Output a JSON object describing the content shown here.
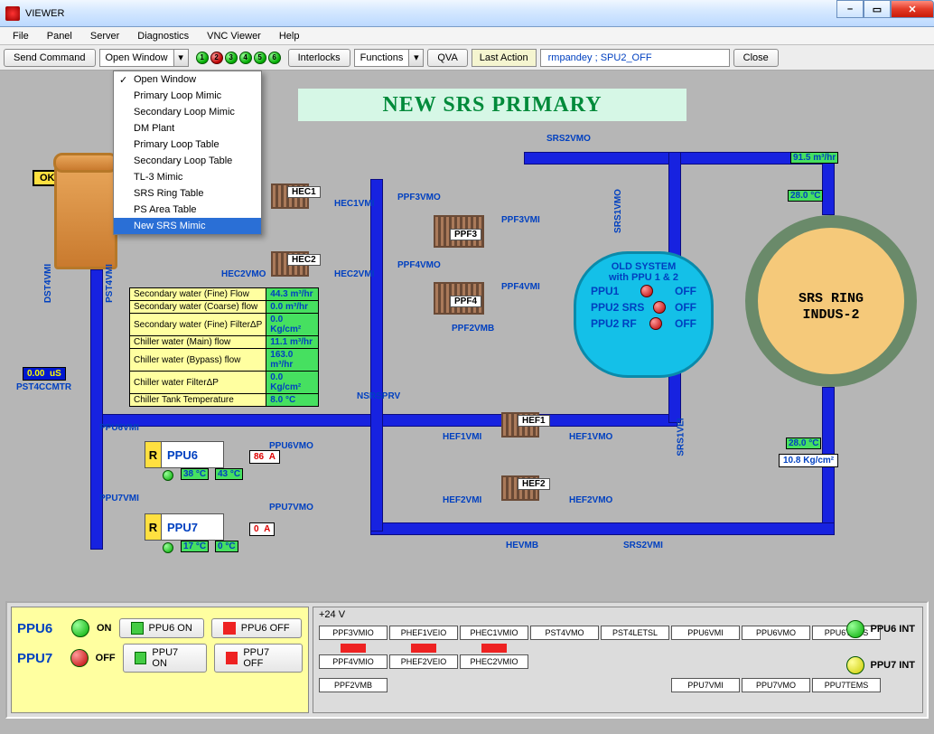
{
  "window": {
    "title": "VIEWER"
  },
  "winbtns": {
    "min": "–",
    "max": "▭",
    "close_sym": "✕"
  },
  "menu": [
    "File",
    "Panel",
    "Server",
    "Diagnostics",
    "VNC Viewer",
    "Help"
  ],
  "toolbar": {
    "send": "Send Command",
    "window_combo": "Open Window",
    "interlocks": "Interlocks",
    "functions": "Functions",
    "qva": "QVA",
    "last_action": "Last Action",
    "user": "rmpandey ; SPU2_OFF",
    "close": "Close",
    "dots": [
      "1",
      "2",
      "3",
      "4",
      "5",
      "6"
    ]
  },
  "dropdown": [
    "Open Window",
    "Primary Loop Mimic",
    "Secondary Loop Mimic",
    "DM Plant",
    "Primary Loop Table",
    "Secondary Loop Table",
    "TL-3 Mimic",
    "SRS Ring Table",
    "PS Area Table",
    "New SRS Mimic"
  ],
  "dropdown_checked": 0,
  "dropdown_selected": 9,
  "title_banner": "NEW SRS PRIMARY",
  "ok_label": "OK",
  "labels": {
    "SRS2VMO": "SRS2VMO",
    "HEC1": "HEC1",
    "HEC1VMI": "HEC1VMI",
    "HEC2": "HEC2",
    "HEC2VMI": "HEC2VMI",
    "HEC2VMO": "HEC2VMO",
    "PPF3VMO": "PPF3VMO",
    "PPF3VMI": "PPF3VMI",
    "PPF3": "PPF3",
    "PPF4VMO": "PPF4VMO",
    "PPF4VMI": "PPF4VMI",
    "PPF4": "PPF4",
    "PPF2VMB": "PPF2VMB",
    "SRS1VMO": "SRS1VMO",
    "NSRSPRV": "NSRSPRV",
    "PPU6VMI": "PPU6VMI",
    "PPU6VMO": "PPU6VMO",
    "PPU7VMI": "PPU7VMI",
    "PPU7VMO": "PPU7VMO",
    "HEF1": "HEF1",
    "HEF1VMI": "HEF1VMI",
    "HEF1VMO": "HEF1VMO",
    "HEF2": "HEF2",
    "HEF2VMI": "HEF2VMI",
    "HEF2VMO": "HEF2VMO",
    "HEVMB": "HEVMB",
    "SRS2VMI": "SRS2VMI",
    "SRS1VEI": "SRS1VEI",
    "DST4VMI": "DST4VMI",
    "PST4VMI": "PST4VMI",
    "PST4CCMTR": "PST4CCMTR",
    "PPU6": "PPU6",
    "PPU7": "PPU7"
  },
  "measurements": [
    {
      "name": "Secondary water (Fine) Flow",
      "value": "44.3",
      "unit": "m³/hr"
    },
    {
      "name": "Secondary water (Coarse) flow",
      "value": "0.0",
      "unit": "m³/hr"
    },
    {
      "name": "Secondary water (Fine) FilterΔP",
      "value": "0.0",
      "unit": "Kg/cm²"
    },
    {
      "name": "Chiller water (Main) flow",
      "value": "11.1",
      "unit": "m³/hr"
    },
    {
      "name": "Chiller water (Bypass) flow",
      "value": "163.0",
      "unit": "m³/hr"
    },
    {
      "name": "Chiller water FilterΔP",
      "value": "0.0",
      "unit": "Kg/cm²"
    },
    {
      "name": "Chiller Tank Temperature",
      "value": "8.0",
      "unit": "°C"
    }
  ],
  "pst4_cond": "0.00",
  "pst4_cond_unit": "uS",
  "flow_top": "91.5 m³/hr",
  "temp_top": "28.0 °C",
  "ring_temp": "28.0 °C",
  "ring_press": "10.8 Kg/cm²",
  "ppu6_current": {
    "v": "86",
    "u": "A"
  },
  "ppu7_current": {
    "v": "0",
    "u": "A"
  },
  "ppu6_t1": "38 °C",
  "ppu6_t2": "43 °C",
  "ppu7_t1": "17 °C",
  "ppu7_t2": "0 °C",
  "oldsys": {
    "title1": "OLD SYSTEM",
    "title2": "with PPU 1 & 2",
    "rows": [
      [
        "PPU1",
        "OFF"
      ],
      [
        "PPU2 SRS",
        "OFF"
      ],
      [
        "PPU2 RF",
        "OFF"
      ]
    ]
  },
  "ring_text": [
    "SRS RING",
    "INDUS-2"
  ],
  "bottom": {
    "ppu6": {
      "label": "PPU6",
      "state": "ON",
      "on": "PPU6 ON",
      "off": "PPU6 OFF"
    },
    "ppu7": {
      "label": "PPU7",
      "state": "OFF",
      "on": "PPU7 ON",
      "off": "PPU7 OFF"
    },
    "vlabel": "+24 V",
    "int6": "PPU6 INT",
    "int7": "PPU7 INT",
    "nodes_top": [
      "PPF3VMIO",
      "PHEF1VEIO",
      "PHEC1VMIO",
      "PST4VMO",
      "PST4LETSL",
      "PPU6VMI",
      "PPU6VMO",
      "PPU6TEMS"
    ],
    "nodes_mid": [
      "PPF4VMIO",
      "PHEF2VEIO",
      "PHEC2VMIO"
    ],
    "nodes_bot": [
      "PPF2VMB",
      "",
      "",
      "",
      "",
      "PPU7VMI",
      "PPU7VMO",
      "PPU7TEMS"
    ]
  }
}
